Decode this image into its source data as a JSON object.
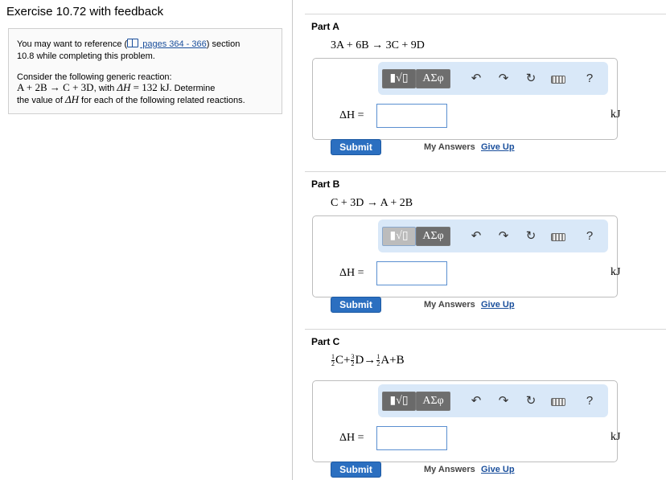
{
  "title": "Exercise 10.72 with feedback",
  "reference": {
    "line1_pre": "You may want to reference (",
    "line1_link": " pages 364 - 366",
    "line1_post": ") section",
    "line2": "10.8 while completing this problem.",
    "line3": "Consider the following generic reaction:",
    "line4_eq": "A + 2B → C + 3D",
    "line4_with": ", with",
    "line4_dh": "ΔH",
    "line4_val": " = 132 kJ",
    "line4_post": ". Determine",
    "line5_pre": "the value of",
    "line5_dh": "ΔH",
    "line5_post": "for each of the following related reactions."
  },
  "parts": [
    {
      "label": "Part A",
      "reaction": "3A  +  6B  →  3C  +  9D",
      "delta_h_label": "ΔH =",
      "input_value": "",
      "unit": "kJ",
      "submit_label": "Submit",
      "my_answers_label": "My Answers",
      "give_up_label": "Give Up",
      "template_label": "▮√▯",
      "symbols_label": "ΑΣφ",
      "undo": "↶",
      "redo": "↷",
      "reset": "↻",
      "help": "?"
    },
    {
      "label": "Part B",
      "reaction": "C  +  3D  →  A  +  2B",
      "delta_h_label": "ΔH =",
      "input_value": "",
      "unit": "kJ",
      "submit_label": "Submit",
      "my_answers_label": "My Answers",
      "give_up_label": "Give Up",
      "template_label": "▮√▯",
      "symbols_label": "ΑΣφ",
      "undo": "↶",
      "redo": "↷",
      "reset": "↻",
      "help": "?"
    },
    {
      "label": "Part C",
      "reaction_parts": {
        "f1_num": "1",
        "f1_den": "2",
        "t1": "C+",
        "f2_num": "3",
        "f2_den": "2",
        "t2": "D→",
        "f3_num": "1",
        "f3_den": "2",
        "t3": "A+B"
      },
      "delta_h_label": "ΔH =",
      "input_value": "",
      "unit": "kJ",
      "submit_label": "Submit",
      "my_answers_label": "My Answers",
      "give_up_label": "Give Up",
      "template_label": "▮√▯",
      "symbols_label": "ΑΣφ",
      "undo": "↶",
      "redo": "↷",
      "reset": "↻",
      "help": "?"
    }
  ],
  "colors": {
    "submit": "#2b6fc0",
    "toolbar_bg": "#d9e8f8",
    "link": "#1a4f9c"
  }
}
